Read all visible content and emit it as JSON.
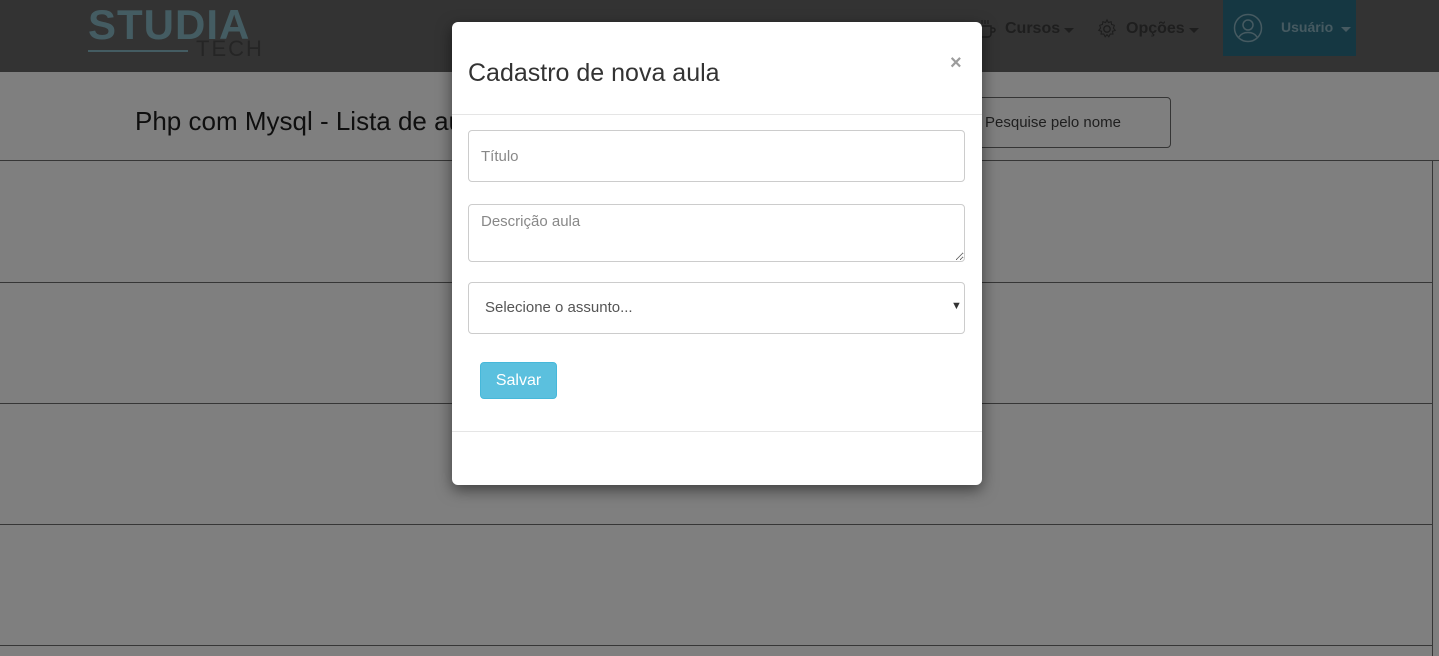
{
  "navbar": {
    "logo": {
      "main": "STUDIA",
      "sub": "TECH"
    },
    "cursos_label": "Cursos",
    "opcoes_label": "Opções",
    "user_label": "Usuário"
  },
  "page": {
    "title": "Php com Mysql - Lista de aulas",
    "search_placeholder": "Pesquise pelo nome"
  },
  "modal": {
    "title": "Cadastro de nova aula",
    "close_label": "×",
    "titulo_placeholder": "Título",
    "descricao_placeholder": "Descrição aula",
    "select_value": "Selecione o assunto...",
    "save_label": "Salvar"
  },
  "colors": {
    "accent": "#5bc0de",
    "user_box": "#2a6f84",
    "logo": "#88b8c4"
  }
}
